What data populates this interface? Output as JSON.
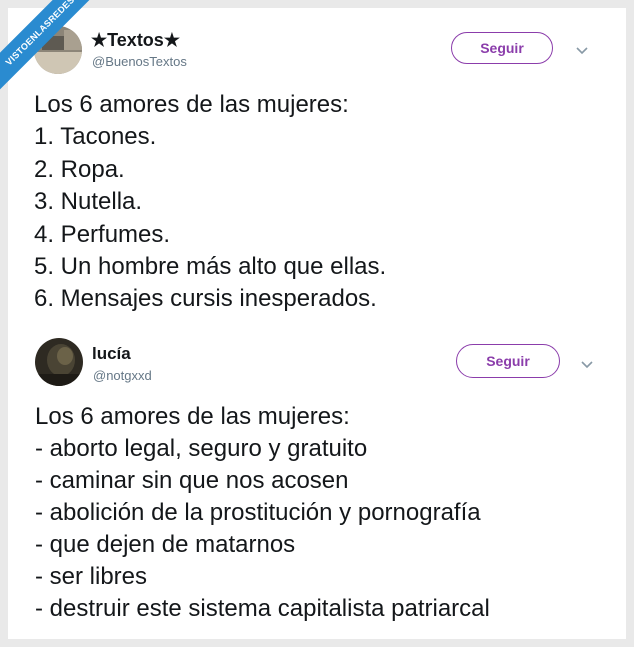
{
  "watermark": {
    "text": "VISTOENLASREDES"
  },
  "tweets": [
    {
      "author_name": "★Textos★",
      "author_handle": "@BuenosTextos",
      "follow_label": "Seguir",
      "avatar_icon": "avatar-photo",
      "lines": [
        "Los 6 amores de las mujeres:",
        "1. Tacones.",
        "2. Ropa.",
        "3. Nutella.",
        "4. Perfumes.",
        "5. Un hombre más alto que ellas.",
        "6. Mensajes cursis inesperados."
      ]
    },
    {
      "author_name": "lucía",
      "author_handle": "@notgxxd",
      "follow_label": "Seguir",
      "avatar_icon": "avatar-photo",
      "lines": [
        "Los 6 amores de las mujeres:",
        "- aborto legal, seguro y gratuito",
        "- caminar sin que nos acosen",
        "- abolición de la prostitución y pornografía",
        "- que dejen de matarnos",
        "- ser libres",
        "- destruir este sistema capitalista patriarcal"
      ]
    }
  ],
  "colors": {
    "accent": "#8b3dab",
    "banner": "#2a8bd0",
    "text": "#14171a",
    "muted": "#657786"
  }
}
